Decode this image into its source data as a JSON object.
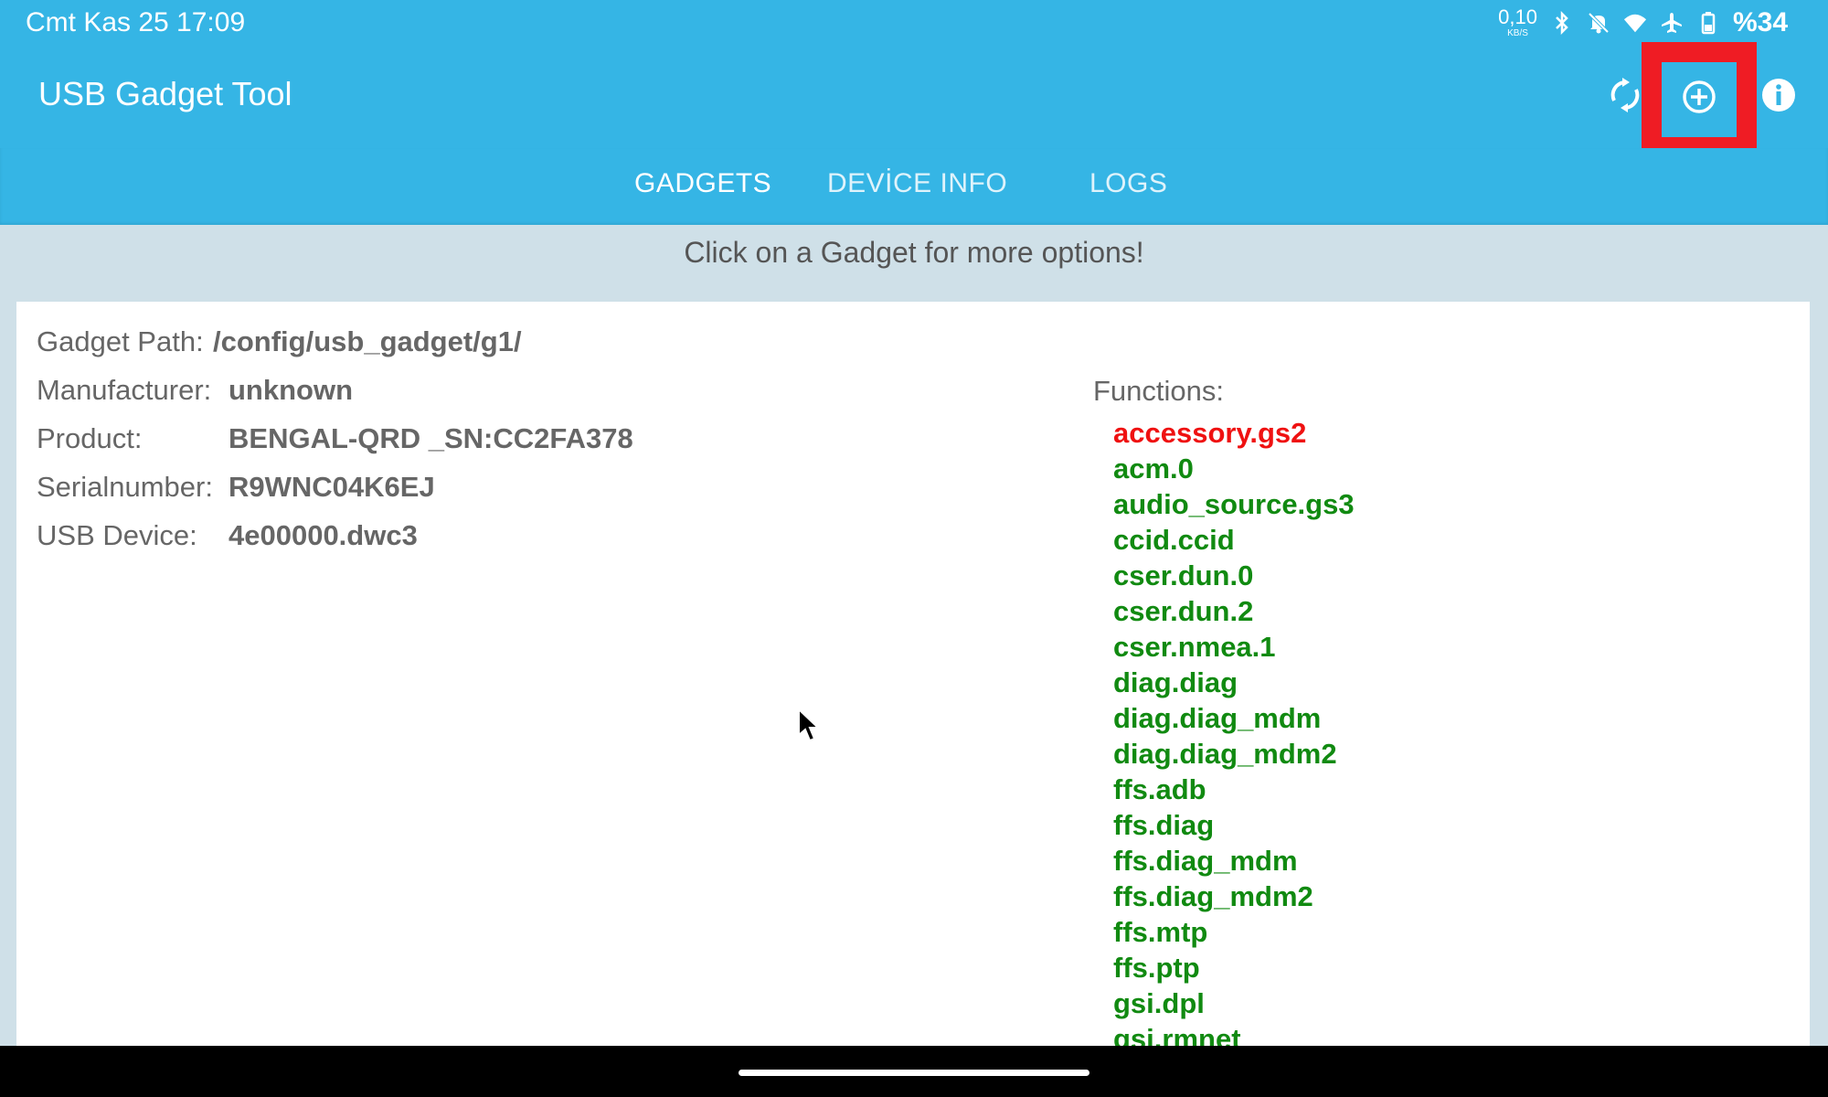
{
  "status_bar": {
    "time": "Cmt Kas 25 17:09",
    "net_speed_value": "0,10",
    "net_speed_unit": "KB/S",
    "battery": "%34",
    "icons": [
      "bluetooth-icon",
      "bell-muted-icon",
      "wifi-icon",
      "airplane-mode-icon",
      "battery-icon"
    ]
  },
  "app_bar": {
    "title": "USB Gadget Tool",
    "actions": [
      "sync-icon",
      "add-circle-icon",
      "info-icon"
    ]
  },
  "tabs": [
    {
      "label": "GADGETS",
      "active": true
    },
    {
      "label": "DEVİCE INFO",
      "active": false
    },
    {
      "label": "LOGS",
      "active": false
    }
  ],
  "hint": "Click on a Gadget for more options!",
  "gadget": {
    "path_label": "Gadget Path:",
    "path_value": "/config/usb_gadget/g1/",
    "manufacturer_label": "Manufacturer:",
    "manufacturer_value": "unknown",
    "product_label": "Product:",
    "product_value": "BENGAL-QRD _SN:CC2FA378",
    "serial_label": "Serialnumber:",
    "serial_value": "R9WNC04K6EJ",
    "usb_device_label": "USB Device:",
    "usb_device_value": "4e00000.dwc3",
    "functions_label": "Functions:",
    "functions": [
      {
        "name": "accessory.gs2",
        "active": false
      },
      {
        "name": "acm.0",
        "active": true
      },
      {
        "name": "audio_source.gs3",
        "active": true
      },
      {
        "name": "ccid.ccid",
        "active": true
      },
      {
        "name": "cser.dun.0",
        "active": true
      },
      {
        "name": "cser.dun.2",
        "active": true
      },
      {
        "name": "cser.nmea.1",
        "active": true
      },
      {
        "name": "diag.diag",
        "active": true
      },
      {
        "name": "diag.diag_mdm",
        "active": true
      },
      {
        "name": "diag.diag_mdm2",
        "active": true
      },
      {
        "name": "ffs.adb",
        "active": true
      },
      {
        "name": "ffs.diag",
        "active": true
      },
      {
        "name": "ffs.diag_mdm",
        "active": true
      },
      {
        "name": "ffs.diag_mdm2",
        "active": true
      },
      {
        "name": "ffs.mtp",
        "active": true
      },
      {
        "name": "ffs.ptp",
        "active": true
      },
      {
        "name": "gsi.dpl",
        "active": true
      },
      {
        "name": "gsi.rmnet",
        "active": true
      }
    ]
  },
  "colors": {
    "primary": "#35b5e5",
    "highlight": "#ef1c24",
    "function_active": "#118a11",
    "function_inactive": "#ef1111"
  }
}
